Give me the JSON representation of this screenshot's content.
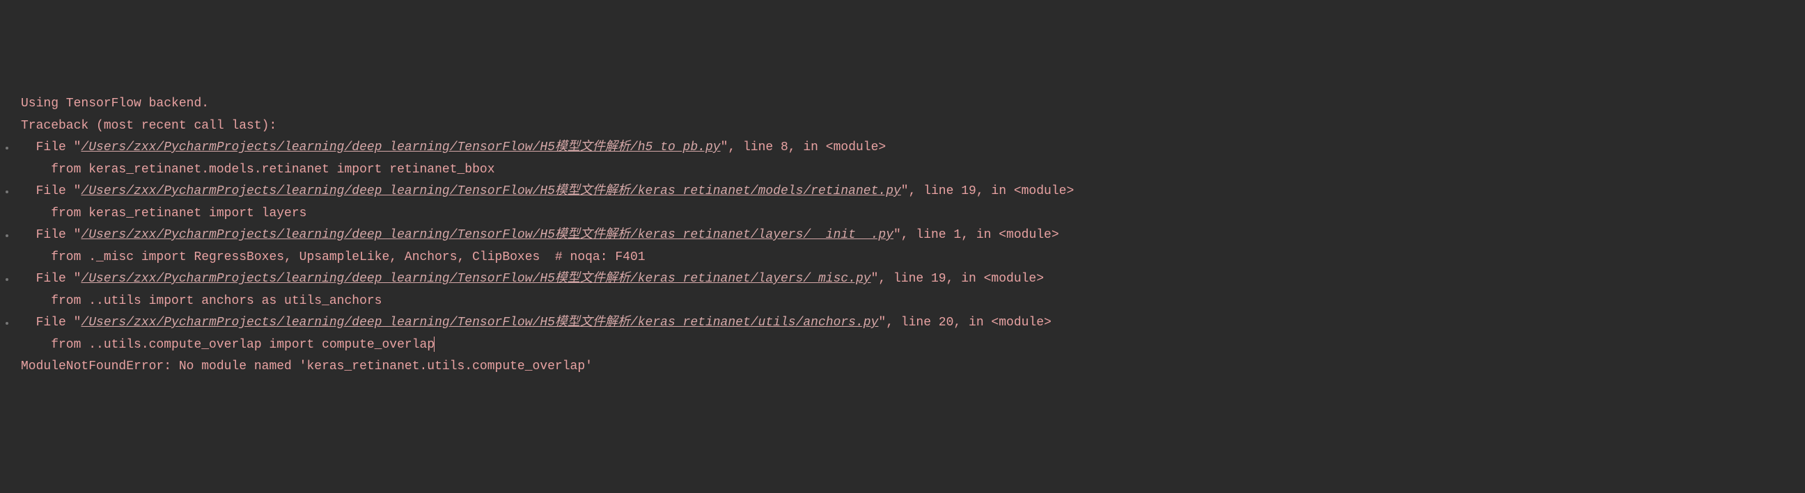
{
  "header": {
    "backend": "Using TensorFlow backend.",
    "traceback": "Traceback (most recent call last):"
  },
  "frames": [
    {
      "file_prefix": "  File \"",
      "path": "/Users/zxx/PycharmProjects/learning/deep_learning/TensorFlow/H5模型文件解析/h5_to_pb.py",
      "suffix_line": "\", line 8, in ",
      "module": "<module>",
      "source": "    from keras_retinanet.models.retinanet import retinanet_bbox"
    },
    {
      "file_prefix": "  File \"",
      "path": "/Users/zxx/PycharmProjects/learning/deep_learning/TensorFlow/H5模型文件解析/keras_retinanet/models/retinanet.py",
      "suffix_line": "\", line 19, in ",
      "module": "<module>",
      "source": "    from keras_retinanet import layers"
    },
    {
      "file_prefix": "  File \"",
      "path": "/Users/zxx/PycharmProjects/learning/deep_learning/TensorFlow/H5模型文件解析/keras_retinanet/layers/__init__.py",
      "suffix_line": "\", line 1, in ",
      "module": "<module>",
      "source": "    from ._misc import RegressBoxes, UpsampleLike, Anchors, ClipBoxes  # noqa: F401"
    },
    {
      "file_prefix": "  File \"",
      "path": "/Users/zxx/PycharmProjects/learning/deep_learning/TensorFlow/H5模型文件解析/keras_retinanet/layers/_misc.py",
      "suffix_line": "\", line 19, in ",
      "module": "<module>",
      "source": "    from ..utils import anchors as utils_anchors"
    },
    {
      "file_prefix": "  File \"",
      "path": "/Users/zxx/PycharmProjects/learning/deep_learning/TensorFlow/H5模型文件解析/keras_retinanet/utils/anchors.py",
      "suffix_line": "\", line 20, in ",
      "module": "<module>",
      "source": "    from ..utils.compute_overlap import compute_overlap"
    }
  ],
  "error": "ModuleNotFoundError: No module named 'keras_retinanet.utils.compute_overlap'"
}
